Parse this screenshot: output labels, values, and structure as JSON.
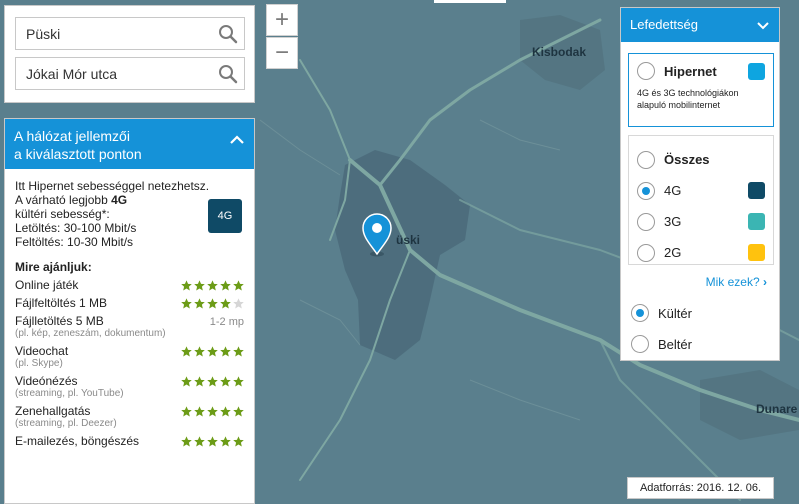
{
  "map": {
    "place_labels": [
      {
        "id": "kisbodak",
        "text": "Kisbodak"
      },
      {
        "id": "puski",
        "text": "üski"
      },
      {
        "id": "dunaremete",
        "text": "Dunare"
      }
    ],
    "colors": {
      "background": "#5a7f8d",
      "area": "#4e6f80",
      "roads": "#7ea7a2"
    }
  },
  "zoom": {
    "in_label": "+",
    "out_label": "−"
  },
  "search": {
    "city_value": "Püski",
    "street_value": "Jókai Mór utca",
    "icon": "search-icon"
  },
  "info": {
    "header_line1": "A hálózat jellemzői",
    "header_line2": "a kiválasztott ponton",
    "intro_line1": "Itt Hipernet sebességgel netezhetsz.",
    "intro_line2_prefix": "A várható legjobb ",
    "intro_line2_tech": "4G",
    "intro_line3": "kültéri sebesség*:",
    "download": "Letöltés: 30-100 Mbit/s",
    "upload": "Feltöltés: 10-30 Mbit/s",
    "badge": "4G",
    "recommend_title": "Mire ajánljuk:",
    "recommendations": [
      {
        "name": "Online játék",
        "sub": "",
        "stars": 5,
        "extra": ""
      },
      {
        "name": "Fájlfeltöltés 1 MB",
        "sub": "",
        "stars": 4,
        "extra": ""
      },
      {
        "name": "Fájlletöltés 5 MB",
        "sub": "(pl. kép, zeneszám, dokumentum)",
        "stars": 0,
        "extra": "1-2 mp"
      },
      {
        "name": "Videochat",
        "sub": "(pl. Skype)",
        "stars": 5,
        "extra": ""
      },
      {
        "name": "Videónézés",
        "sub": "(streaming, pl. YouTube)",
        "stars": 5,
        "extra": ""
      },
      {
        "name": "Zenehallgatás",
        "sub": "(streaming, pl. Deezer)",
        "stars": 5,
        "extra": ""
      },
      {
        "name": "E-mailezés, böngészés",
        "sub": "",
        "stars": 5,
        "extra": ""
      }
    ]
  },
  "coverage": {
    "header": "Lefedettség",
    "hipernet": {
      "label": "Hipernet",
      "desc": "4G és 3G technológiákon alapuló mobilinternet",
      "color": "#0ea5e0",
      "selected": false
    },
    "techs": [
      {
        "label": "Összes",
        "selected": false,
        "color": ""
      },
      {
        "label": "4G",
        "selected": true,
        "color": "#0f4a66"
      },
      {
        "label": "3G",
        "selected": false,
        "color": "#3bb5b3"
      },
      {
        "label": "2G",
        "selected": false,
        "color": "#ffc20e"
      }
    ],
    "mik_link": "Mik ezek?",
    "environments": [
      {
        "label": "Kültér",
        "selected": true
      },
      {
        "label": "Beltér",
        "selected": false
      }
    ]
  },
  "source": "Adatforrás: 2016. 12. 06."
}
